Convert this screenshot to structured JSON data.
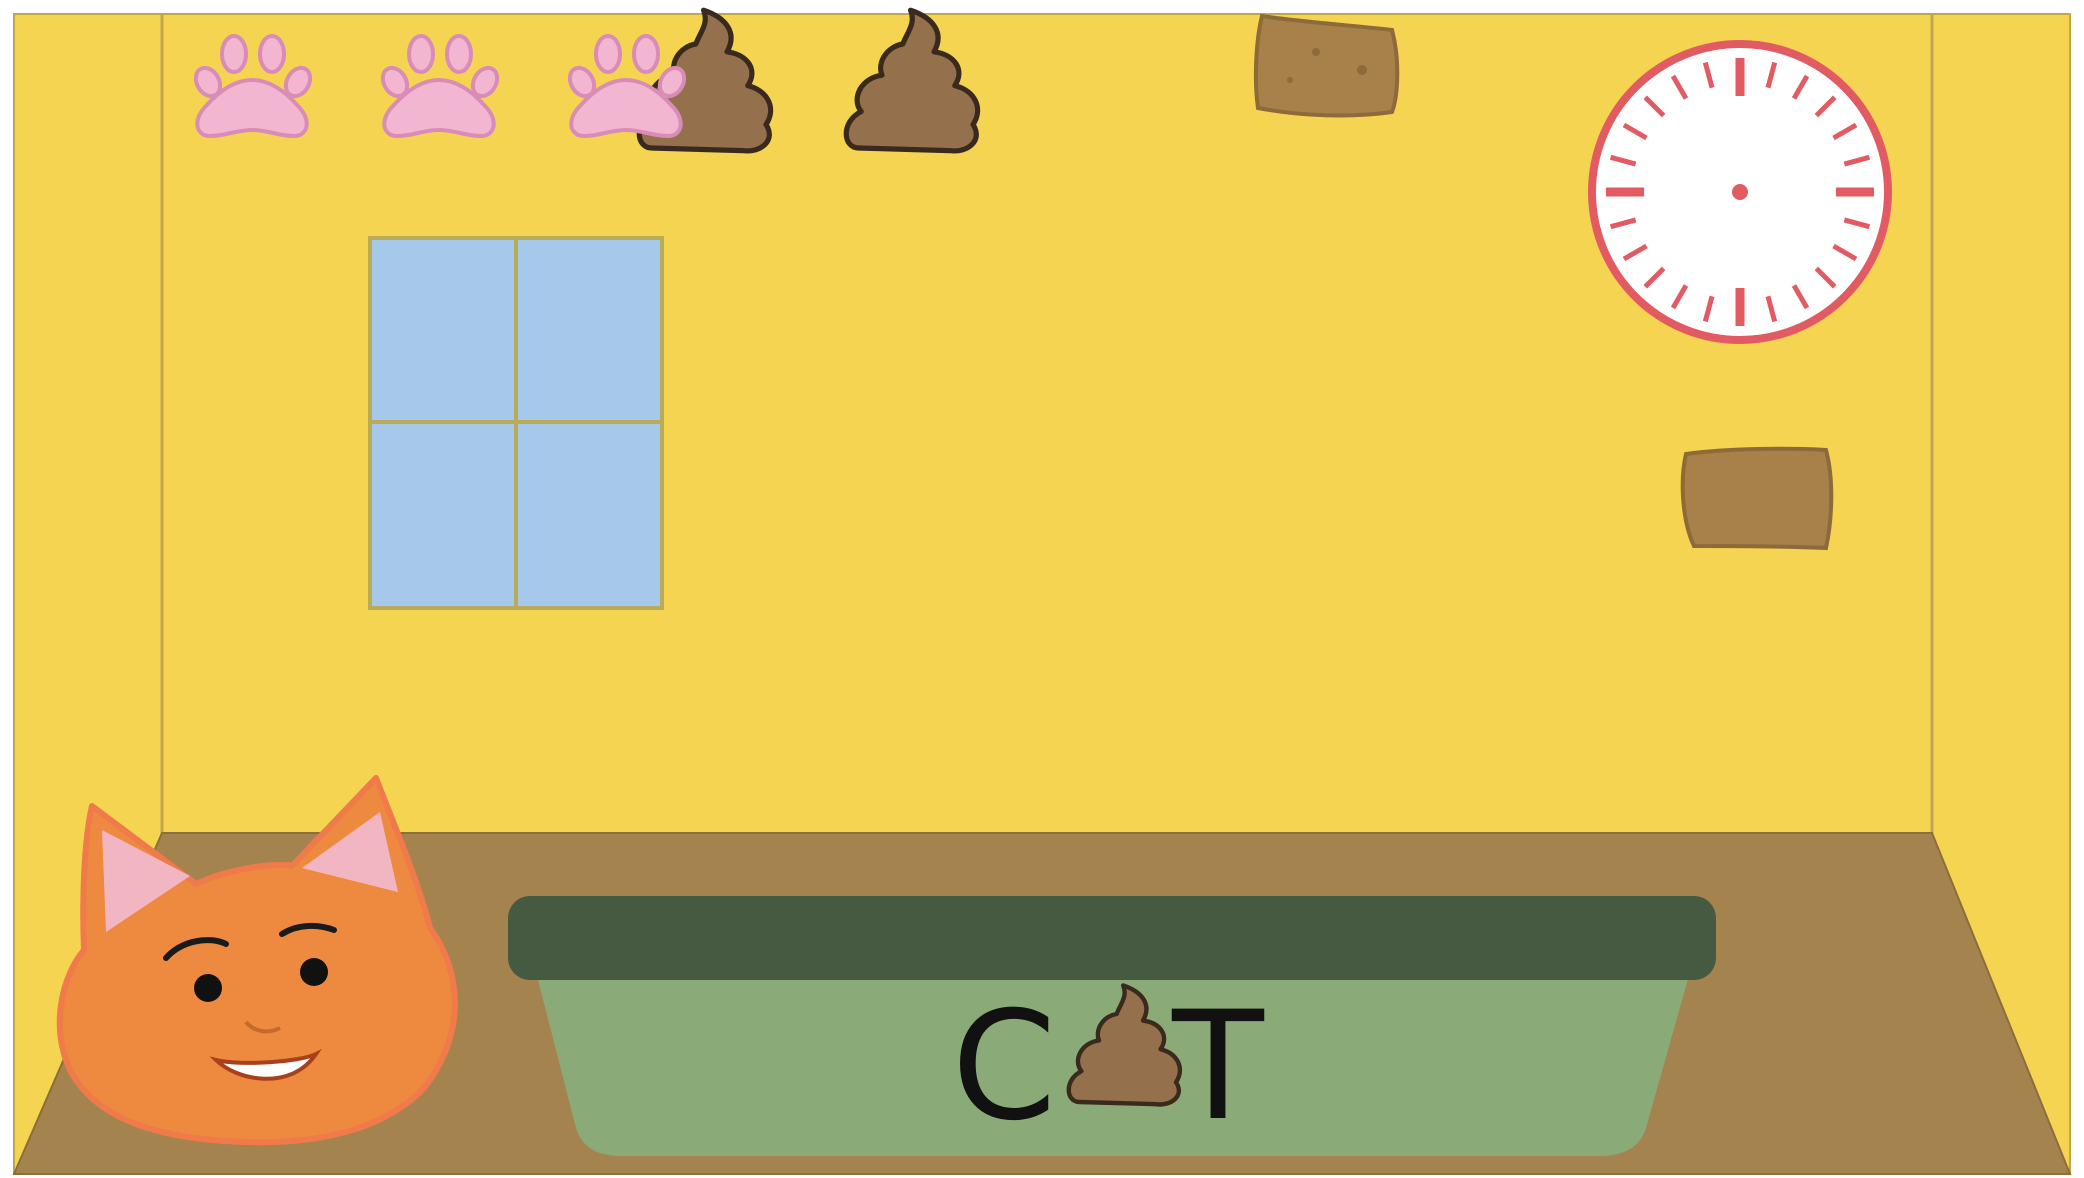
{
  "game": {
    "title_left": "C",
    "title_right": "T",
    "title_middle_icon": "poop-icon",
    "lives": {
      "icon": "paw-icon",
      "count": 3
    },
    "poops_collected": {
      "icon": "poop-icon",
      "count": 2
    },
    "timer": {
      "icon": "clock-icon"
    }
  },
  "scene": {
    "items": [
      "sponge-icon",
      "sponge-icon",
      "window",
      "litter-box",
      "cat-face"
    ]
  },
  "colors": {
    "wall": "#f4d450",
    "wall_line": "#c2a64a",
    "floor": "#a5834f",
    "window": "#a6c8ea",
    "window_frame": "#b9ab58",
    "litter_rim": "#465a41",
    "litter_box": "#8aab78",
    "paw": "#f2b6d0",
    "paw_outline": "#d98cb7",
    "poop": "#94714c",
    "poop_outline": "#3a2a1e",
    "sponge": "#a8804a",
    "clock": "#e25b62",
    "cat": "#ee8a40",
    "cat_outline": "#f07a4a",
    "cat_ear": "#f2b6c2"
  }
}
